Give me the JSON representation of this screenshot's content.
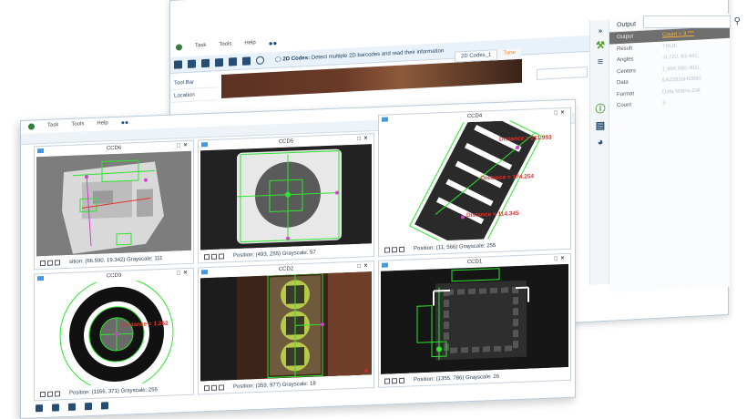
{
  "back_window": {
    "menu": [
      "Task",
      "Tools",
      "Help"
    ],
    "hint_bold": "2D Codes:",
    "hint_text": "Detect multiple 2D barcodes and read their information",
    "sidebar": [
      "Tool Bar",
      "Location"
    ],
    "tabs": [
      "2D Codes_1",
      "Tune"
    ],
    "output": {
      "title": "Output",
      "rows": [
        {
          "key": "Output",
          "value": "Count > 3 ***",
          "selected": true
        },
        {
          "key": "Result",
          "value": "TRUE"
        },
        {
          "key": "Angles",
          "value": "-0.720, 83.441,"
        },
        {
          "key": "Centers",
          "value": "1,964,990,-802,"
        },
        {
          "key": "Data",
          "value": "6A22816HD890"
        },
        {
          "key": "Format",
          "value": "Data Matrix,Dat"
        },
        {
          "key": "Count",
          "value": "3"
        }
      ]
    }
  },
  "front_window": {
    "menu": [
      "Task",
      "Tools",
      "Help"
    ],
    "cells": [
      {
        "id": "ccd6",
        "title": "CCD6",
        "footer": "sition: (66.590, 19.342) Grayscale: 111"
      },
      {
        "id": "ccd5",
        "title": "CCD5",
        "footer": "Position: (493, 255) Grayscale: 57"
      },
      {
        "id": "ccd4",
        "title": "CCD4",
        "footer": "Position: (11, 566) Grayscale: 255"
      },
      {
        "id": "ccd3",
        "title": "CCD3",
        "footer": "Position: (1166, 371) Grayscale: 255"
      },
      {
        "id": "ccd2",
        "title": "CCD2",
        "footer": "Position: (359, 977) Grayscale: 18"
      },
      {
        "id": "ccd1",
        "title": "CCD1",
        "footer": "Position: (1355, 786) Grayscale: 26"
      }
    ],
    "annotations": {
      "ccd4_d1": "Distance = 211.993",
      "ccd4_d2": "Distance = 174.254",
      "ccd4_d3": "Distance = 114.345",
      "ccd3_d1": "Distance = 1.262"
    }
  },
  "colors": {
    "accent": "#264d73",
    "overlay_green": "#2ee52e",
    "overlay_magenta": "#d13fd1",
    "measure_red": "#e4312b",
    "highlight": "#f7b733"
  }
}
